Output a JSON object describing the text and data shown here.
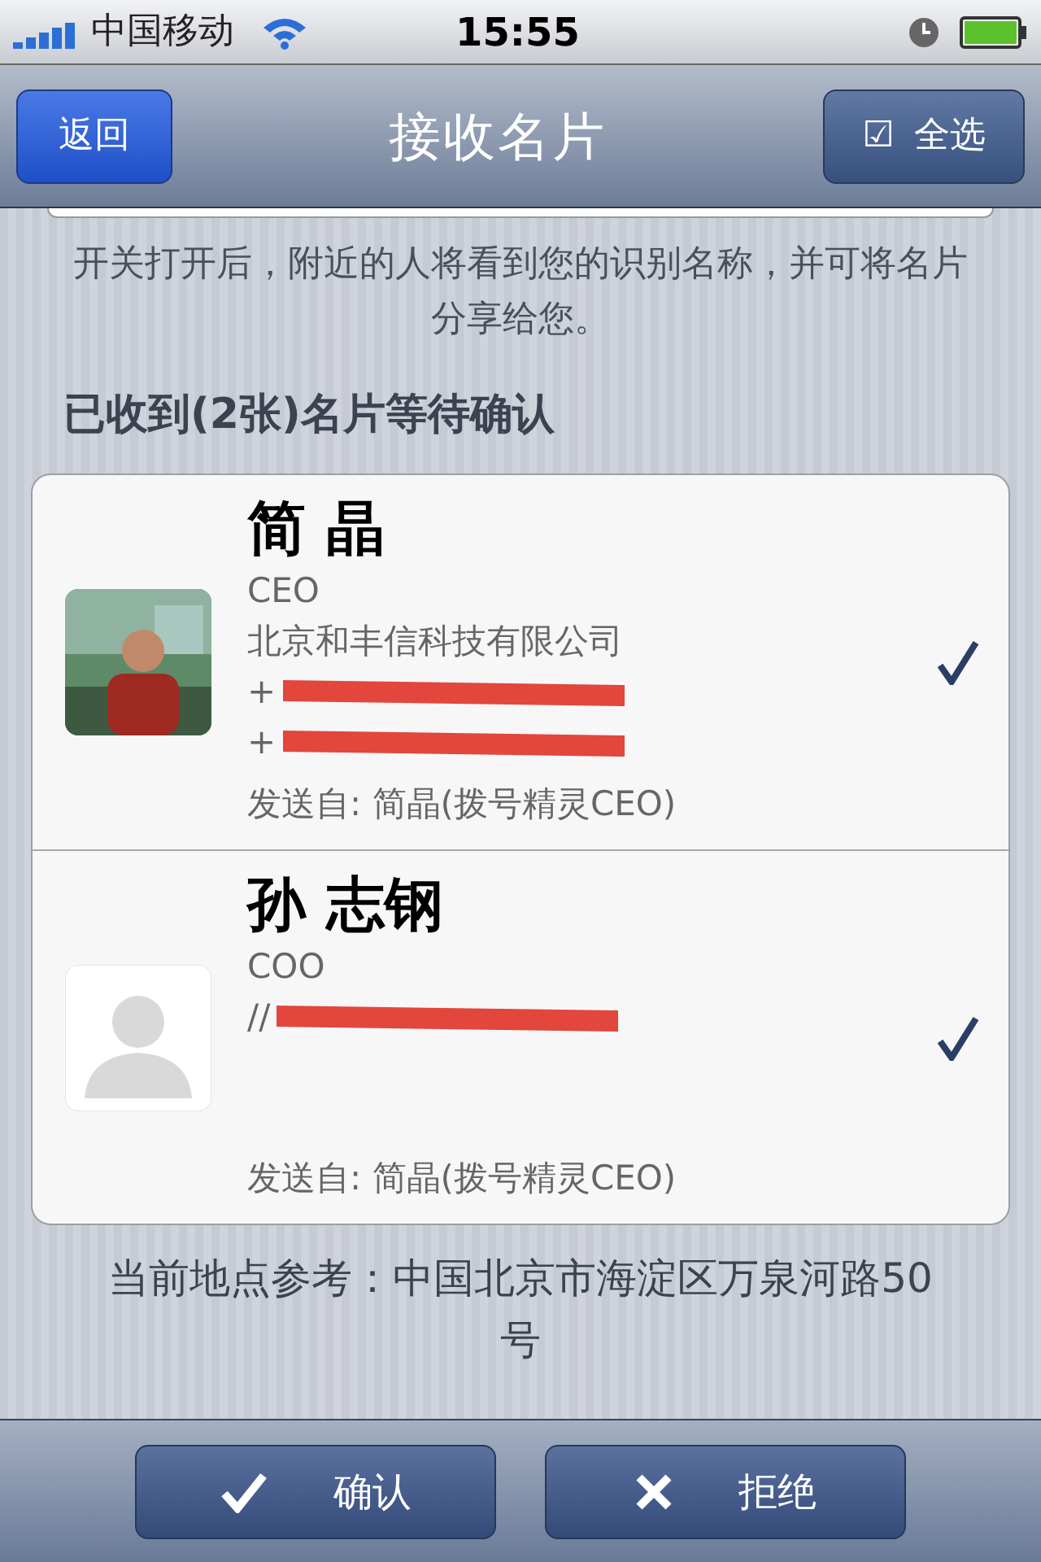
{
  "status_bar": {
    "carrier": "中国移动",
    "time": "15:55"
  },
  "nav": {
    "back": "返回",
    "title": "接收名片",
    "select_all": {
      "icon": "☑",
      "label": "全选"
    }
  },
  "hint": "开关打开后，附近的人将看到您的识别名称，并可将名片分享给您。",
  "heading": "已收到(2张)名片等待确认",
  "cards": [
    {
      "name": "简 晶",
      "lines": [
        "CEO",
        "北京和丰信科技有限公司"
      ],
      "phones": [
        {
          "prefix": "+"
        },
        {
          "prefix": "+"
        }
      ],
      "sender": "发送自: 简晶(拨号精灵CEO)",
      "selected": true
    },
    {
      "name": "孙 志钢",
      "avatar": {
        "kind": "silhouette"
      },
      "lines": [
        "COO"
      ],
      "phones": [
        {
          "prefix": "//"
        }
      ],
      "sender": "发送自: 简晶(拨号精灵CEO)",
      "selected": true
    }
  ],
  "location": "当前地点参考：中国北京市海淀区万泉河路50号",
  "toolbar": [
    {
      "kind": "confirm",
      "label": "确认"
    },
    {
      "kind": "reject",
      "label": "拒绝"
    }
  ]
}
